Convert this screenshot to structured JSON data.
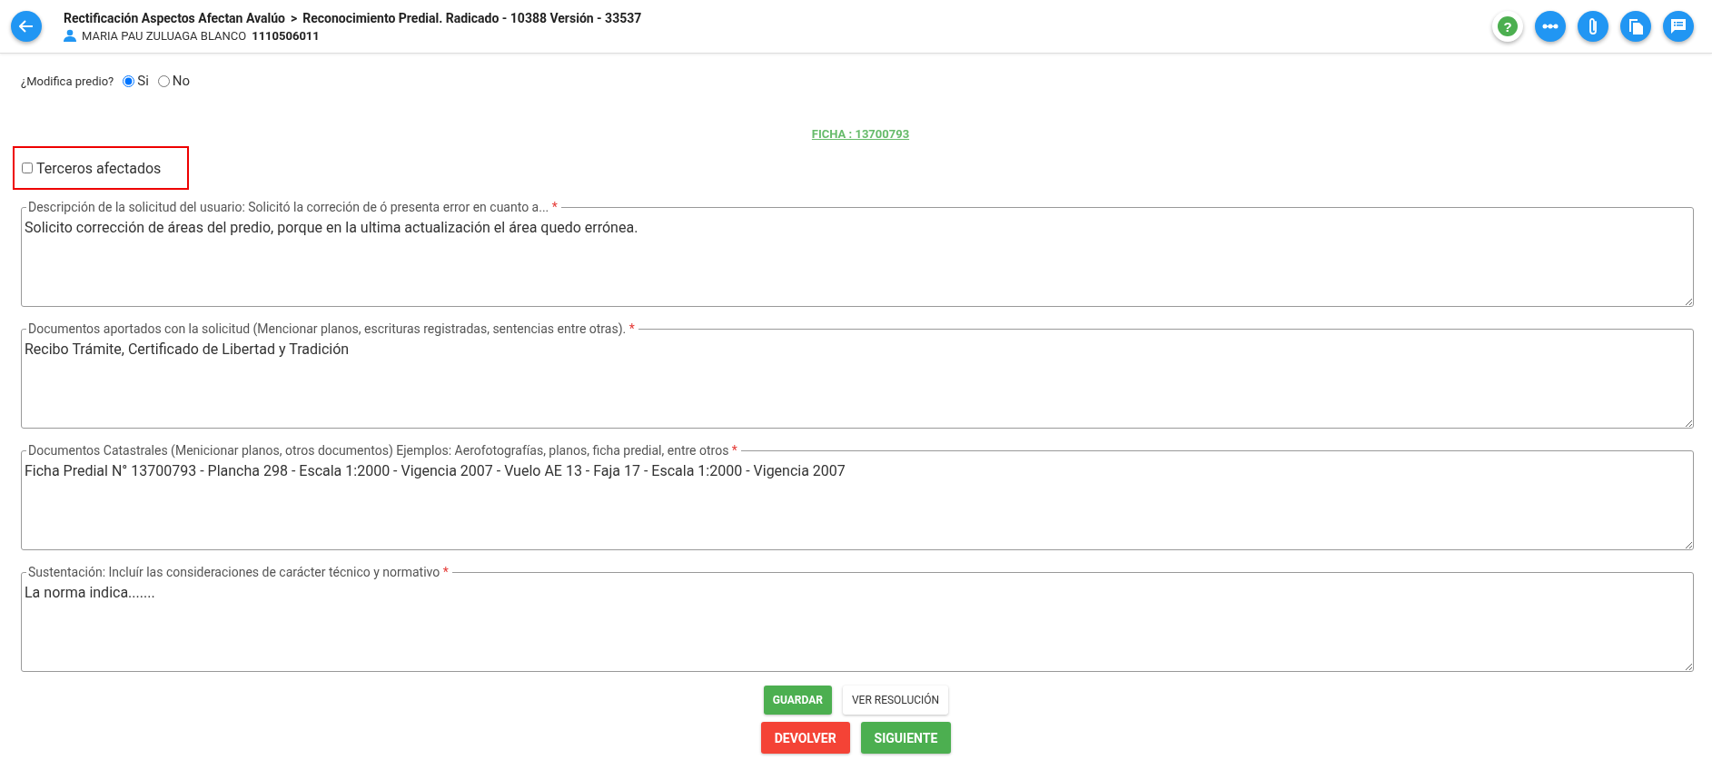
{
  "header": {
    "breadcrumb": [
      "Rectificación Aspectos Afectan Avalúo",
      "Reconocimiento Predial. Radicado - 10388 Versión - 33537"
    ],
    "separator": ">",
    "user_name": "MARIA PAU ZULUAGA BLANCO",
    "user_id": "1110506011"
  },
  "toolbar": [
    {
      "kind": "help",
      "label": "?"
    },
    {
      "kind": "flow"
    },
    {
      "kind": "attach"
    },
    {
      "kind": "copy"
    },
    {
      "kind": "comments"
    }
  ],
  "modifica": {
    "label": "¿Modifica predio?",
    "options": [
      {
        "label": "Si",
        "selected": true
      },
      {
        "label": "No",
        "selected": false
      }
    ]
  },
  "ficha_link": "FICHA : 13700793",
  "terceros": {
    "label": "Terceros afectados",
    "checked": false,
    "highlighted": true
  },
  "fields": [
    {
      "label": "Descripción de la solicitud del usuario: Solicitó la correción de ó presenta error en cuanto a...",
      "required_mark": "*",
      "value": "Solicito corrección de áreas del predio, porque en la ultima actualización el área quedo errónea."
    },
    {
      "label": "Documentos aportados con la solicitud (Mencionar planos, escrituras registradas, sentencias entre otras).",
      "required_mark": "*",
      "value": "Recibo Trámite, Certificado de Libertad y Tradición"
    },
    {
      "label": "Documentos Catastrales (Menicionar planos, otros documentos) Ejemplos: Aerofotografías, planos, ficha predial, entre otros",
      "required_mark": "*",
      "value": "Ficha Predial N° 13700793 - Plancha 298 - Escala 1:2000 - Vigencia 2007 - Vuelo AE 13 - Faja 17 - Escala 1:2000 - Vigencia 2007"
    },
    {
      "label": "Sustentación: Incluír las consideraciones de carácter técnico y normativo",
      "required_mark": "*",
      "value": "La norma indica......."
    }
  ],
  "buttons": [
    [
      {
        "label": "GUARDAR",
        "kind": "success"
      },
      {
        "label": "VER RESOLUCIÓN",
        "kind": "plain"
      }
    ],
    [
      {
        "label": "DEVOLVER",
        "kind": "danger"
      },
      {
        "label": "SIGUIENTE",
        "kind": "success"
      }
    ]
  ]
}
